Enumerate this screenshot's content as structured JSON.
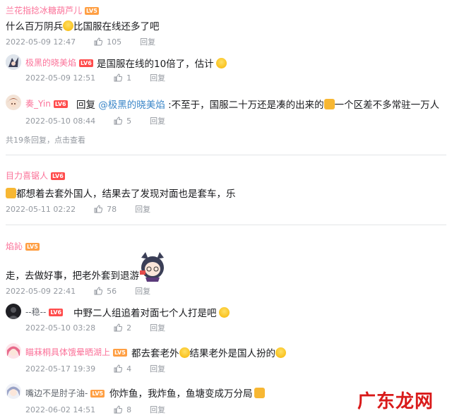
{
  "comments": [
    {
      "user": "兰花指捻冰糖葫芦儿",
      "level": "LV5",
      "text_a": "什么百万阴兵",
      "text_b": "比国服在线还多了吧",
      "time": "2022-05-09 12:47",
      "likes": "105",
      "reply": "回复"
    },
    {
      "user": "极黑的晓美焰",
      "level": "LV6",
      "text": "是国服在线的10倍了，估计",
      "time": "2022-05-09 12:51",
      "likes": "1",
      "reply": "回复"
    },
    {
      "user": "奏_Yin",
      "level": "LV6",
      "reply_prefix": "回复 ",
      "mention": "@极黑的晓美焰",
      "text_a": " :不至于，国服二十万还是凑的出来的",
      "text_b": "一个区差不多常驻一万人",
      "time": "2022-05-10 08:44",
      "likes": "5",
      "reply": "回复"
    },
    {
      "replies_summary": "共19条回复，",
      "see_more": "点击查看"
    },
    {
      "user": "目力喜锯人",
      "level": "LV6",
      "text": "都想着去套外国人，结果去了发现对面也是套车，乐",
      "time": "2022-05-11 02:22",
      "likes": "78",
      "reply": "回复"
    },
    {
      "user": "焰訫",
      "level": "LV5",
      "text": "走，去做好事，把老外套到退游",
      "time": "2022-05-09 22:41",
      "likes": "56",
      "reply": "回复"
    },
    {
      "user": "--稳--",
      "level": "LV6",
      "text": "中野二人组追着对面七个人打是吧",
      "time": "2022-05-10 03:28",
      "likes": "2",
      "reply": "回复"
    },
    {
      "user": "瞄菻桐具体饿晕晒湖上",
      "level": "LV5",
      "text_a": "都去套老外",
      "text_b": "结果老外是国人扮的",
      "time": "2022-05-17 19:39",
      "likes": "4",
      "reply": "回复"
    },
    {
      "user": "嘴边不是肘子油-",
      "level": "LV5",
      "text": "你炸鱼，我炸鱼，鱼塘变成万分局",
      "time": "2022-06-02 14:51",
      "likes": "8",
      "reply": "回复"
    }
  ],
  "watermark": "广东龙网",
  "colors": {
    "username": "#fb7299",
    "meta": "#9499a0",
    "mention": "#3a86c8",
    "watermark": "#d91a1a"
  }
}
